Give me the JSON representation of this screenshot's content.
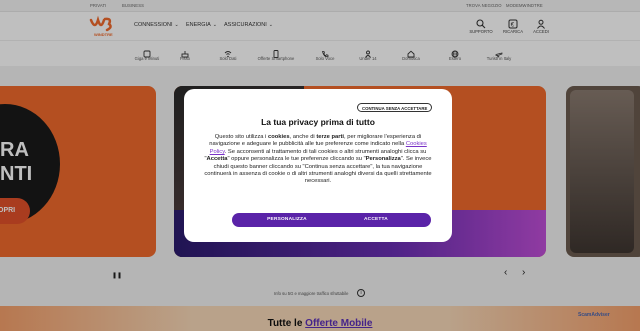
{
  "topbar": {
    "links": [
      "PRIVATI",
      "BUSINESS"
    ],
    "right_links": [
      "TROVA NEGOZIO",
      "MODEMWINDTRE"
    ]
  },
  "header": {
    "logo_text": "WINDTRE",
    "nav": [
      "CONNESSIONI",
      "ENERGIA",
      "ASSICURAZIONI"
    ],
    "actions": [
      {
        "label": "SUPPORTO",
        "icon": "search-icon"
      },
      {
        "label": "RICARICA",
        "icon": "euro-icon"
      },
      {
        "label": "ACCEDI",
        "icon": "user-icon"
      }
    ]
  },
  "categories": [
    {
      "label": "Giga e Minuti",
      "icon": "sim-icon"
    },
    {
      "label": "Fisso",
      "icon": "router-icon"
    },
    {
      "label": "Solo Dati",
      "icon": "wifi-icon"
    },
    {
      "label": "Offerte Smartphone",
      "icon": "smartphone-icon"
    },
    {
      "label": "Solo Voce",
      "icon": "phone-icon"
    },
    {
      "label": "Under 14",
      "icon": "child-icon"
    },
    {
      "label": "Domotica",
      "icon": "home-icon"
    },
    {
      "label": "Estero",
      "icon": "globe-icon"
    },
    {
      "label": "Turisti in Italy",
      "icon": "plane-icon"
    }
  ],
  "carousel": {
    "left_card_text": "RA\nNTI",
    "left_card_cta": "OPRI",
    "pause": "❚❚",
    "prev": "‹",
    "next": "›",
    "note": "Info su 5G e maggiore traffico sfruttabile"
  },
  "bottom": {
    "title_prefix": "Tutte le ",
    "title_link": "Offerte Mobile",
    "watermark": "ScamAdviser"
  },
  "modal": {
    "close_label": "CONTINUA SENZA ACCETTARE",
    "title": "La tua privacy prima di tutto",
    "body": {
      "p1": "Questo sito utilizza i ",
      "b1": "cookies",
      "p2": ", anche di ",
      "b2": "terze parti",
      "p3": ", per migliorare l'esperienza di navigazione e adeguare le pubblicità alle tue preferenze come indicato nella ",
      "link": "Cookies Policy",
      "p4": ". Se acconsenti al trattamento di tali cookies o altri strumenti analoghi clicca su \"",
      "b3": "Accetta",
      "p5": "\" oppure personalizza le tue preferenze cliccando su \"",
      "b4": "Personalizza",
      "p6": "\". Se invece chiudi questo banner cliccando su \"Continua senza accettare\", la tua navigazione continuerà in assenza di cookie o di altri strumenti analoghi diversi da quelli strettamente necessari."
    },
    "btn_customize": "PERSONALIZZA",
    "btn_accept": "ACCETTA"
  },
  "colors": {
    "brand_orange": "#f06a2c",
    "brand_purple": "#5a23a8"
  }
}
